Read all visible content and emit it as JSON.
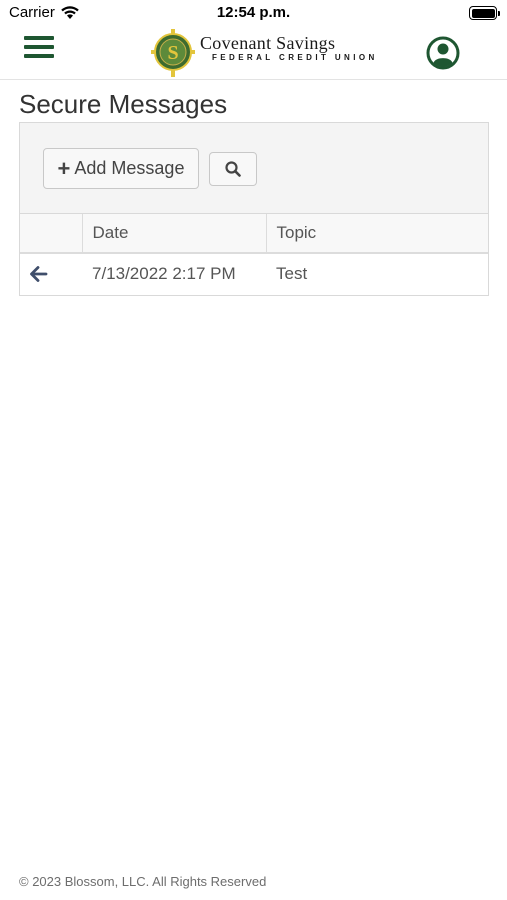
{
  "status_bar": {
    "carrier": "Carrier",
    "time": "12:54 p.m.",
    "icons": [
      "wifi-icon",
      "battery-icon"
    ]
  },
  "header": {
    "logo_name": "Covenant Savings",
    "logo_subtitle": "FEDERAL CREDIT UNION",
    "logo_seal_letter": "S",
    "icons": [
      "menu-icon",
      "profile-icon"
    ],
    "brand_color": "#1e5631",
    "accent_color": "#e3c53c"
  },
  "page": {
    "title": "Secure Messages"
  },
  "toolbar": {
    "add_label": "Add Message",
    "add_icon": "plus-icon",
    "search_icon": "search-icon"
  },
  "table": {
    "columns": [
      "",
      "Date",
      "Topic"
    ],
    "rows": [
      {
        "icon": "arrow-left-icon",
        "date": "7/13/2022 2:17 PM",
        "topic": "Test"
      }
    ]
  },
  "footer": {
    "text": "© 2023 Blossom, LLC. All Rights Reserved"
  }
}
